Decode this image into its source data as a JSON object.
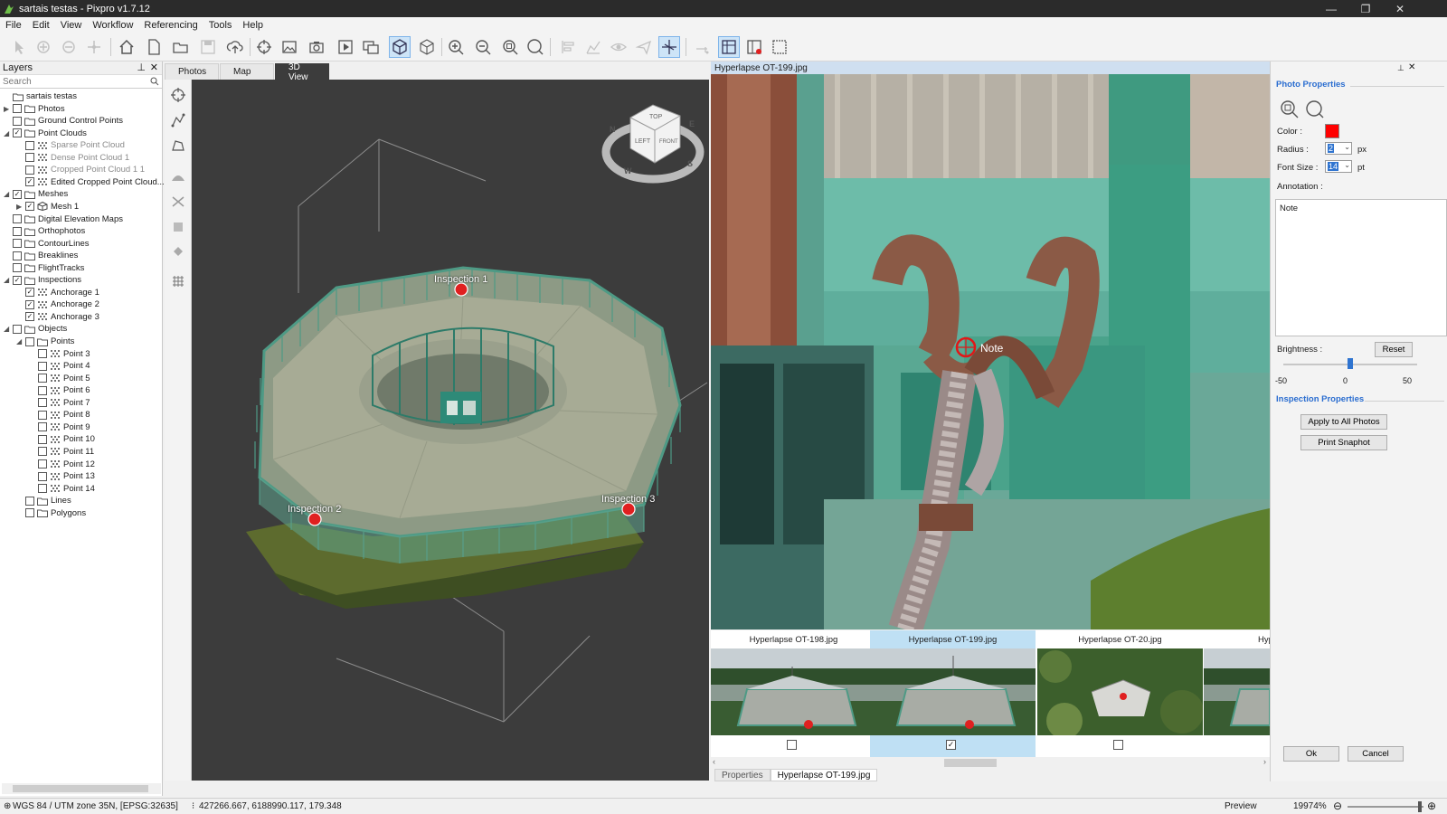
{
  "window": {
    "title": "sartais testas - Pixpro v1.7.12",
    "controls": [
      "—",
      "❐",
      "✕"
    ]
  },
  "menu": [
    "File",
    "Edit",
    "View",
    "Workflow",
    "Referencing",
    "Tools",
    "Help"
  ],
  "layers": {
    "title": "Layers",
    "search_placeholder": "Search",
    "items": [
      {
        "label": "sartais testas",
        "level": 0,
        "arrow": "",
        "check": null,
        "icon": "project"
      },
      {
        "label": "Photos",
        "level": 0,
        "arrow": "▶",
        "check": false,
        "icon": "folder"
      },
      {
        "label": "Ground Control Points",
        "level": 0,
        "arrow": "",
        "check": false,
        "icon": "folder"
      },
      {
        "label": "Point Clouds",
        "level": 0,
        "arrow": "◢",
        "check": true,
        "icon": "folder"
      },
      {
        "label": "Sparse Point Cloud",
        "level": 1,
        "arrow": "",
        "check": false,
        "icon": "points",
        "dim": true
      },
      {
        "label": "Dense Point Cloud 1",
        "level": 1,
        "arrow": "",
        "check": false,
        "icon": "points",
        "dim": true
      },
      {
        "label": "Cropped Point Cloud 1 1",
        "level": 1,
        "arrow": "",
        "check": false,
        "icon": "points",
        "dim": true
      },
      {
        "label": "Edited Cropped Point Cloud...",
        "level": 1,
        "arrow": "",
        "check": true,
        "icon": "points"
      },
      {
        "label": "Meshes",
        "level": 0,
        "arrow": "◢",
        "check": true,
        "icon": "folder"
      },
      {
        "label": "Mesh 1",
        "level": 1,
        "arrow": "▶",
        "check": true,
        "icon": "mesh"
      },
      {
        "label": "Digital Elevation Maps",
        "level": 0,
        "arrow": "",
        "check": false,
        "icon": "folder"
      },
      {
        "label": "Orthophotos",
        "level": 0,
        "arrow": "",
        "check": false,
        "icon": "folder"
      },
      {
        "label": "ContourLines",
        "level": 0,
        "arrow": "",
        "check": false,
        "icon": "folder"
      },
      {
        "label": "Breaklines",
        "level": 0,
        "arrow": "",
        "check": false,
        "icon": "folder"
      },
      {
        "label": "FlightTracks",
        "level": 0,
        "arrow": "",
        "check": false,
        "icon": "folder"
      },
      {
        "label": "Inspections",
        "level": 0,
        "arrow": "◢",
        "check": true,
        "icon": "folder"
      },
      {
        "label": "Anchorage 1",
        "level": 1,
        "arrow": "",
        "check": true,
        "icon": "points"
      },
      {
        "label": "Anchorage 2",
        "level": 1,
        "arrow": "",
        "check": true,
        "icon": "points"
      },
      {
        "label": "Anchorage 3",
        "level": 1,
        "arrow": "",
        "check": true,
        "icon": "points"
      },
      {
        "label": "Objects",
        "level": 0,
        "arrow": "◢",
        "check": false,
        "icon": "folder"
      },
      {
        "label": "Points",
        "level": 1,
        "arrow": "◢",
        "check": false,
        "icon": "folder"
      },
      {
        "label": "Point 3",
        "level": 2,
        "arrow": "",
        "check": false,
        "icon": "points"
      },
      {
        "label": "Point 4",
        "level": 2,
        "arrow": "",
        "check": false,
        "icon": "points"
      },
      {
        "label": "Point 5",
        "level": 2,
        "arrow": "",
        "check": false,
        "icon": "points"
      },
      {
        "label": "Point 6",
        "level": 2,
        "arrow": "",
        "check": false,
        "icon": "points"
      },
      {
        "label": "Point 7",
        "level": 2,
        "arrow": "",
        "check": false,
        "icon": "points"
      },
      {
        "label": "Point 8",
        "level": 2,
        "arrow": "",
        "check": false,
        "icon": "points"
      },
      {
        "label": "Point 9",
        "level": 2,
        "arrow": "",
        "check": false,
        "icon": "points"
      },
      {
        "label": "Point 10",
        "level": 2,
        "arrow": "",
        "check": false,
        "icon": "points"
      },
      {
        "label": "Point 11",
        "level": 2,
        "arrow": "",
        "check": false,
        "icon": "points"
      },
      {
        "label": "Point 12",
        "level": 2,
        "arrow": "",
        "check": false,
        "icon": "points"
      },
      {
        "label": "Point 13",
        "level": 2,
        "arrow": "",
        "check": false,
        "icon": "points"
      },
      {
        "label": "Point 14",
        "level": 2,
        "arrow": "",
        "check": false,
        "icon": "points"
      },
      {
        "label": "Lines",
        "level": 1,
        "arrow": "",
        "check": false,
        "icon": "folder"
      },
      {
        "label": "Polygons",
        "level": 1,
        "arrow": "",
        "check": false,
        "icon": "folder"
      }
    ]
  },
  "tabs": [
    "Photos",
    "Map",
    "3D View"
  ],
  "active_tab": "3D View",
  "view3d": {
    "inspections": [
      "Inspection 1",
      "Inspection 2",
      "Inspection 3"
    ],
    "navcube": {
      "top": "TOP",
      "left": "LEFT",
      "front": "FRONT",
      "compass": [
        "N",
        "E",
        "S",
        "W"
      ]
    }
  },
  "photo_viewer": {
    "title": "Hyperlapse OT-199.jpg",
    "note_label": "Note"
  },
  "filmstrip": [
    {
      "name": "Hyperlapse OT-198.jpg",
      "checked": false,
      "selected": false
    },
    {
      "name": "Hyperlapse OT-199.jpg",
      "checked": true,
      "selected": true
    },
    {
      "name": "Hyperlapse OT-20.jpg",
      "checked": false,
      "selected": false
    },
    {
      "name": "Hyperla",
      "checked": false,
      "selected": false
    }
  ],
  "photo_tabs": [
    "Properties",
    "Hyperlapse OT-199.jpg"
  ],
  "properties": {
    "photo_title": "Photo Properties",
    "color_label": "Color :",
    "color_value": "#ff0000",
    "radius_label": "Radius :",
    "radius_value": "2",
    "radius_unit": "px",
    "font_label": "Font Size :",
    "font_value": "14",
    "font_unit": "pt",
    "annotation_label": "Annotation :",
    "annotation_text": "Note",
    "brightness_label": "Brightness :",
    "reset_label": "Reset",
    "slider_min": "-50",
    "slider_mid": "0",
    "slider_max": "50",
    "brightness_value": 0,
    "inspection_title": "Inspection Properties",
    "apply_all": "Apply to All Photos",
    "print_snapshot": "Print Snaphot",
    "ok": "Ok",
    "cancel": "Cancel"
  },
  "status": {
    "crs": "WGS 84 / UTM zone 35N, [EPSG:32635]",
    "coords": "427266.667, 6188990.117, 179.348",
    "mode": "Preview",
    "zoom": "19974%"
  }
}
